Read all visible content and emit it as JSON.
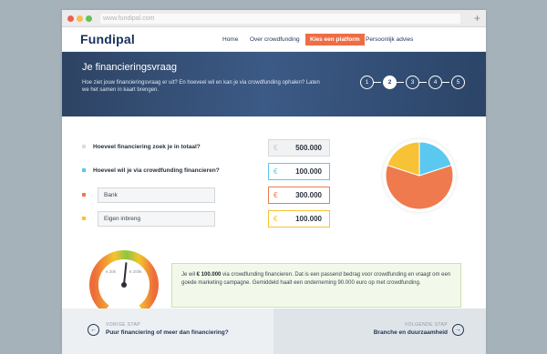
{
  "browser": {
    "url": "www.fundipal.com",
    "new_tab": "+"
  },
  "nav": {
    "logo": "Fundipal",
    "items": [
      "Home",
      "Over crowdfunding",
      "Kies een platform",
      "Persoonlijk advies"
    ]
  },
  "hero": {
    "title": "Je financieringsvraag",
    "text": "Hoe ziet jouw financieringsvraag er uit? En hoeveel wil en kan je via crowdfunding ophalen? Laten we het samen in kaart brengen.",
    "steps": [
      "1",
      "2",
      "3",
      "4",
      "5"
    ],
    "active_step": 2
  },
  "form": {
    "q1": "Hoeveel financiering zoek je in totaal?",
    "q2": "Hoeveel wil je via crowdfunding financieren?",
    "bank_label": "Bank",
    "eigen_label": "Eigen inbreng",
    "currency": "€",
    "total_value": "500.000",
    "crowd_value": "100.000",
    "bank_value": "300.000",
    "eigen_value": "100.000"
  },
  "colors": {
    "accent": "#ee6d45",
    "navy": "#1e3255",
    "total": "#d8d8d8",
    "crowd": "#5bc8f0",
    "bank": "#ef7a4e",
    "eigen": "#f7c235"
  },
  "chart_data": {
    "type": "pie",
    "categories": [
      "Crowdfunding",
      "Bank",
      "Eigen inbreng"
    ],
    "values": [
      100000,
      300000,
      100000
    ]
  },
  "gauge": {
    "label_low": "€ 20k",
    "label_high": "€ 200k",
    "value_fraction": 0.52
  },
  "info": {
    "text_before": "Je wil ",
    "amount": "€ 100.000",
    "text_after": " via crowdfunding financieren. Dat is een passend bedrag voor crowdfunding en vraagt om een goede marketing campagne. Gemiddeld haalt een onderneming 90.000 euro op met crowdfunding."
  },
  "footer": {
    "prev_small": "VORIGE STAP",
    "prev_big": "Puur financiering of meer dan financiering?",
    "next_small": "VOLGENDE STAP",
    "next_big": "Branche en duurzaamheid",
    "prev_icon": "arrow-left-icon",
    "next_icon": "arrow-right-icon"
  }
}
